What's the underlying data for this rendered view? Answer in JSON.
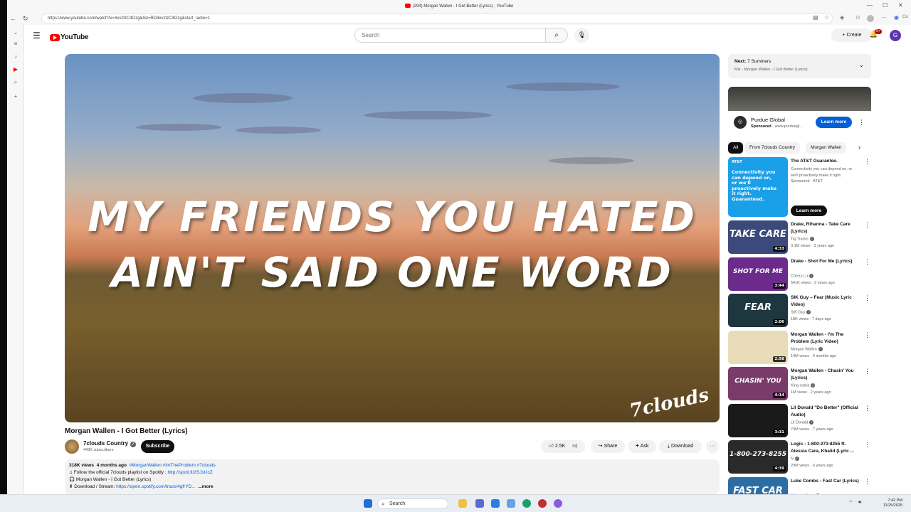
{
  "browser": {
    "tab_title": "(294) Morgan Wallen - I Got Better (Lyrics) - YouTube",
    "url": "https://www.youtube.com/watch?v=4xv2lzC4Gzg&list=RD4xv2lzC4Gzg&start_radio=1",
    "copilot_label": "Co"
  },
  "youtube": {
    "logo_text": "YouTube",
    "search_placeholder": "Search",
    "create_label": "Create",
    "notification_count": "9+",
    "avatar_letter": "G"
  },
  "video": {
    "lyric_line1": "MY FRIENDS YOU HATED",
    "lyric_line2": "AIN'T SAID ONE WORD",
    "watermark": "7clouds",
    "title": "Morgan Wallen - I Got Better (Lyrics)",
    "channel": "7clouds Country",
    "subscribers": "443K subscribers",
    "subscribe_label": "Subscribe",
    "likes": "2.5K",
    "share_label": "Share",
    "ask_label": "Ask",
    "download_label": "Download"
  },
  "description": {
    "views": "318K views",
    "age": "4 months ago",
    "tags": "#MorganWallen #ImTheProblem #7clouds",
    "line1_text": "Follow the official 7clouds playlist on Spotify : ",
    "line1_link": "http://spoti.fi/2SJsUcZ",
    "line2_text": "Morgan Wallen - I Got Better (Lyrics)",
    "line3_text": "Download / Stream: ",
    "line3_link": "https://open.spotify.com/track/4gfrYD...",
    "more": "...more"
  },
  "next_up": {
    "label": "Next:",
    "title": "7 Summers",
    "subtitle": "Mix - Morgan Wallen - I Got Better (Lyrics)"
  },
  "ad": {
    "name": "Purdue Global",
    "sponsored": "Sponsored",
    "domain": "www.purduegl...",
    "button": "Learn more"
  },
  "chips": [
    "All",
    "From 7clouds Country",
    "Morgan Wallen"
  ],
  "recommendations": [
    {
      "title": "The AT&T Guarantee.",
      "desc": "Connectivity you can depend on, or we'll proactively make it right.",
      "channel": "Sponsored · AT&T",
      "thumb_text": "Connectivity you can depend on, or we'll proactively make it right. Guaranteed.",
      "thumb_brand": "AT&T",
      "button": "Learn more"
    },
    {
      "title": "Drake, Rihanna - Take Care (Lyrics)",
      "channel": "Taj Tracks",
      "meta": "3.1M views · 3 years ago",
      "duration": "4:33",
      "thumb_text": "TAKE CARE",
      "color": "#3b4a7a"
    },
    {
      "title": "Drake - Shot For Me (Lyrics)",
      "channel": "Cherry Lu",
      "meta": "541K views · 2 years ago",
      "duration": "3:44",
      "thumb_text": "SHOT FOR ME",
      "color": "#6b2a8c"
    },
    {
      "title": "SIK Guy – Fear (Music Lyric Video)",
      "channel": "SIK Guy",
      "meta": "18K views · 7 days ago",
      "duration": "2:06",
      "thumb_text": "FEAR",
      "color": "#1d3640"
    },
    {
      "title": "Morgan Wallen - I'm The Problem (Lyric Video)",
      "channel": "Morgan Wallen",
      "meta": "14M views · 9 months ago",
      "duration": "2:58",
      "thumb_text": "",
      "color": "#e8dcb8"
    },
    {
      "title": "Morgan Wallen - Chasin' You (Lyrics)",
      "channel": "King cobra",
      "meta": "1M views · 2 years ago",
      "duration": "4:14",
      "thumb_text": "CHASIN' YOU",
      "color": "#7a3a6a"
    },
    {
      "title": "Lil Donald \"Do Better\" (Official Audio)",
      "channel": "Lil Donald",
      "meta": "74M views · 7 years ago",
      "duration": "3:31",
      "thumb_text": "",
      "color": "#1a1a1a"
    },
    {
      "title": "Logic - 1-800-273-8255 ft. Alessia Cara, Khalid (Lyric ...",
      "channel": "N",
      "meta": "29M views · 6 years ago",
      "duration": "4:39",
      "thumb_text": "1-800-273-8255",
      "color": "#2a2a2a"
    },
    {
      "title": "Luke Combs - Fast Car (Lyrics)",
      "channel": "7clouds Rock",
      "meta": "3.2M views · 7 years ago",
      "duration": "",
      "thumb_text": "FAST CAR",
      "color": "#2c6ea3"
    }
  ],
  "taskbar": {
    "search": "Search",
    "time": "7:42 PM",
    "date": "11/25/2025"
  }
}
